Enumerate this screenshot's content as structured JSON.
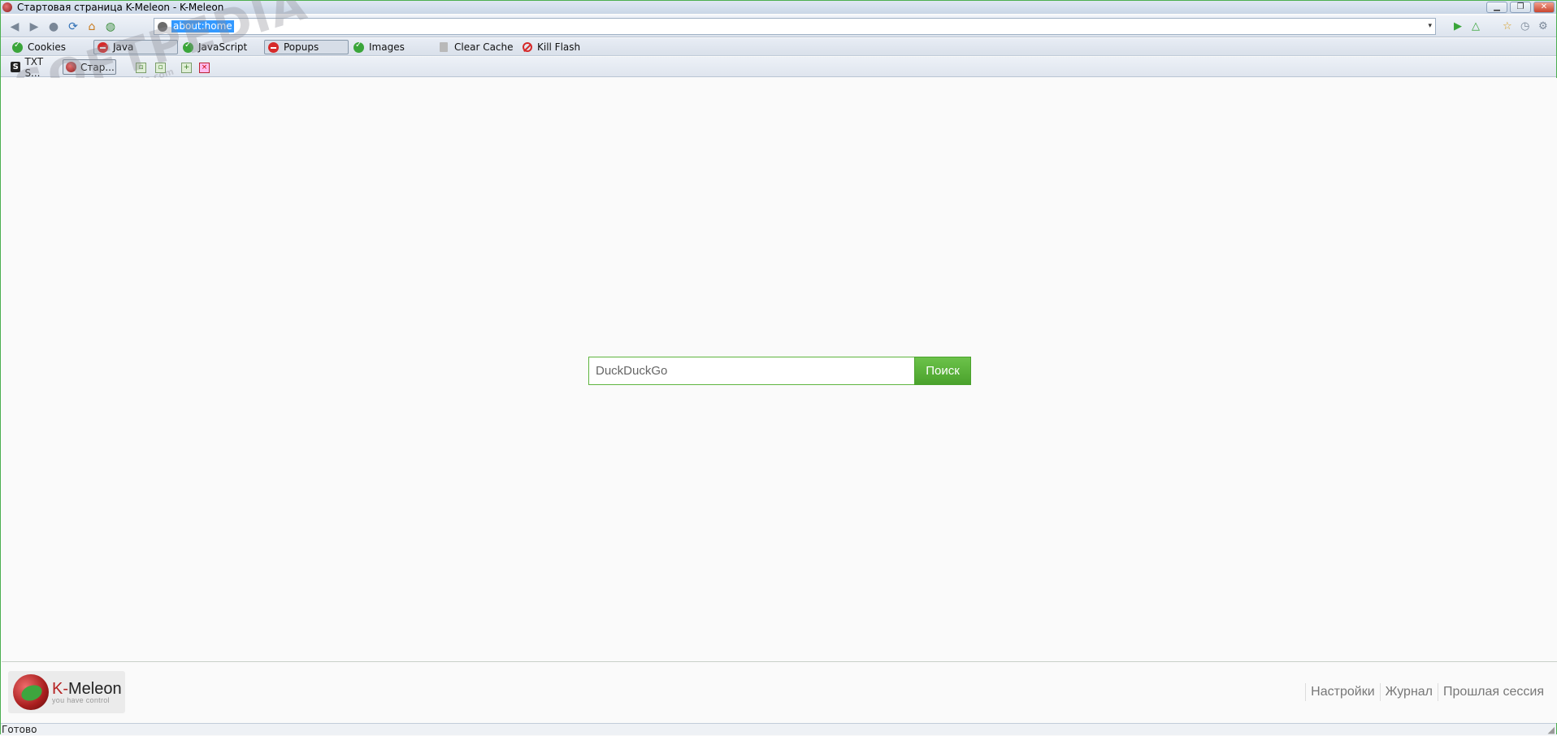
{
  "window": {
    "title": "Стартовая страница K-Meleon - K-Meleon",
    "controls": {
      "minimize": "▁",
      "restore": "❐",
      "close": "✕"
    }
  },
  "nav": {
    "url": "about:home",
    "dropdown": "▾",
    "icons": {
      "back": "◀",
      "forward": "▶",
      "stop": "●",
      "reload": "⟳",
      "home": "⌂",
      "history": "◍",
      "go": "▶",
      "up": "△",
      "bookmark": "☆",
      "mail": "◷",
      "settings": "⚙"
    }
  },
  "privacy_bar": {
    "cookies": "Cookies",
    "java": "Java",
    "javascript": "JavaScript",
    "popups": "Popups",
    "images": "Images",
    "clear_cache": "Clear Cache",
    "kill_flash": "Kill Flash"
  },
  "tabs": [
    {
      "label": "TXT S...",
      "icon": "S"
    },
    {
      "label": "Стар...",
      "icon": ""
    }
  ],
  "watermark": {
    "brand": "SOFTPEDIA",
    "url": "www.softpedia.com"
  },
  "search": {
    "placeholder": "DuckDuckGo",
    "button": "Поиск"
  },
  "footer": {
    "logo_prefix": "K-",
    "logo_name": "Meleon",
    "logo_tag": "you have control",
    "links": [
      "Настройки",
      "Журнал",
      "Прошлая сессия"
    ]
  },
  "status": {
    "text": "Готово"
  },
  "colors": {
    "accent_green": "#4aa22c",
    "selection_blue": "#3399ff",
    "block_red": "#d62a2a"
  }
}
